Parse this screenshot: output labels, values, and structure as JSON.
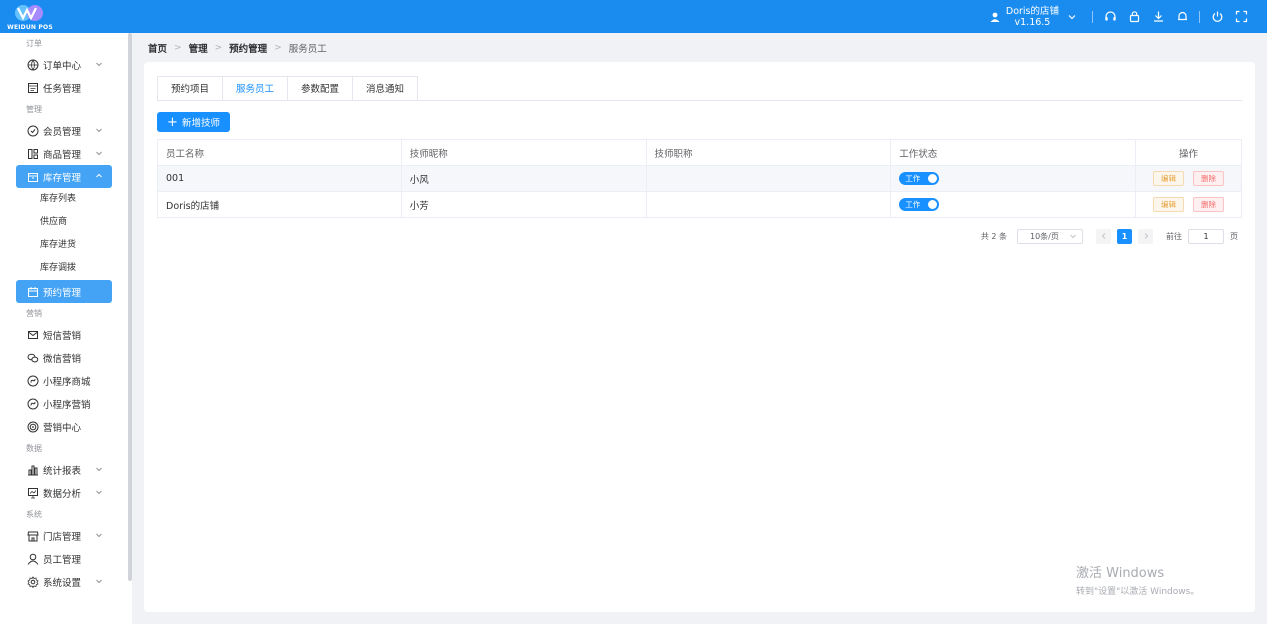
{
  "header": {
    "logo_text": "WEIDUN POS",
    "user_name": "Doris的店铺",
    "version": "v1.16.5",
    "icons": [
      "headset-icon",
      "lock-icon",
      "download-icon",
      "bell-icon",
      "power-icon",
      "fullscreen-icon"
    ],
    "colors": {
      "bar": "#1a8cf0",
      "accent": "#1890ff"
    }
  },
  "sidebar": {
    "groups": [
      {
        "label": "订单",
        "items": [
          {
            "label": "订单中心",
            "icon": "globe-icon",
            "expandable": true
          },
          {
            "label": "任务管理",
            "icon": "task-icon"
          }
        ]
      },
      {
        "label": "管理",
        "items": [
          {
            "label": "会员管理",
            "icon": "member-icon",
            "expandable": true
          },
          {
            "label": "商品管理",
            "icon": "goods-icon",
            "expandable": true
          },
          {
            "label": "库存管理",
            "icon": "inventory-icon",
            "expandable": true,
            "active": true
          },
          {
            "label": "预约管理",
            "icon": "calendar-icon",
            "active": true
          }
        ]
      },
      {
        "label": "营销",
        "items": [
          {
            "label": "短信营销",
            "icon": "mail-icon"
          },
          {
            "label": "微信营销",
            "icon": "wechat-icon"
          },
          {
            "label": "小程序商城",
            "icon": "miniprogram-icon"
          },
          {
            "label": "小程序营销",
            "icon": "miniprogram-icon"
          },
          {
            "label": "营销中心",
            "icon": "target-icon"
          }
        ]
      },
      {
        "label": "数据",
        "items": [
          {
            "label": "统计报表",
            "icon": "chart-icon",
            "expandable": true
          },
          {
            "label": "数据分析",
            "icon": "monitor-icon",
            "expandable": true
          }
        ]
      },
      {
        "label": "系统",
        "items": [
          {
            "label": "门店管理",
            "icon": "store-icon",
            "expandable": true
          },
          {
            "label": "员工管理",
            "icon": "user-icon"
          },
          {
            "label": "系统设置",
            "icon": "gear-icon",
            "expandable": true
          }
        ]
      }
    ],
    "inventory_sub": [
      "库存列表",
      "供应商",
      "库存进货",
      "库存调拨"
    ]
  },
  "breadcrumb": [
    "首页",
    "管理",
    "预约管理",
    "服务员工"
  ],
  "tabs": [
    "预约项目",
    "服务员工",
    "参数配置",
    "消息通知"
  ],
  "active_tab": "服务员工",
  "add_button": "新增技师",
  "table": {
    "columns": [
      "员工名称",
      "技师昵称",
      "技师职称",
      "工作状态",
      "操作"
    ],
    "rows": [
      {
        "name": "001",
        "nickname": "小风",
        "title": "",
        "status": "工作"
      },
      {
        "name": "Doris的店铺",
        "nickname": "小芳",
        "title": "",
        "status": "工作"
      }
    ],
    "edit_label": "编辑",
    "delete_label": "删除"
  },
  "pagination": {
    "total_text": "共 2 条",
    "page_size": "10条/页",
    "current_page": "1",
    "goto_label": "前往",
    "goto_value": "1",
    "page_suffix": "页"
  },
  "watermark": {
    "line1": "激活 Windows",
    "line2": "转到\"设置\"以激活 Windows。"
  }
}
